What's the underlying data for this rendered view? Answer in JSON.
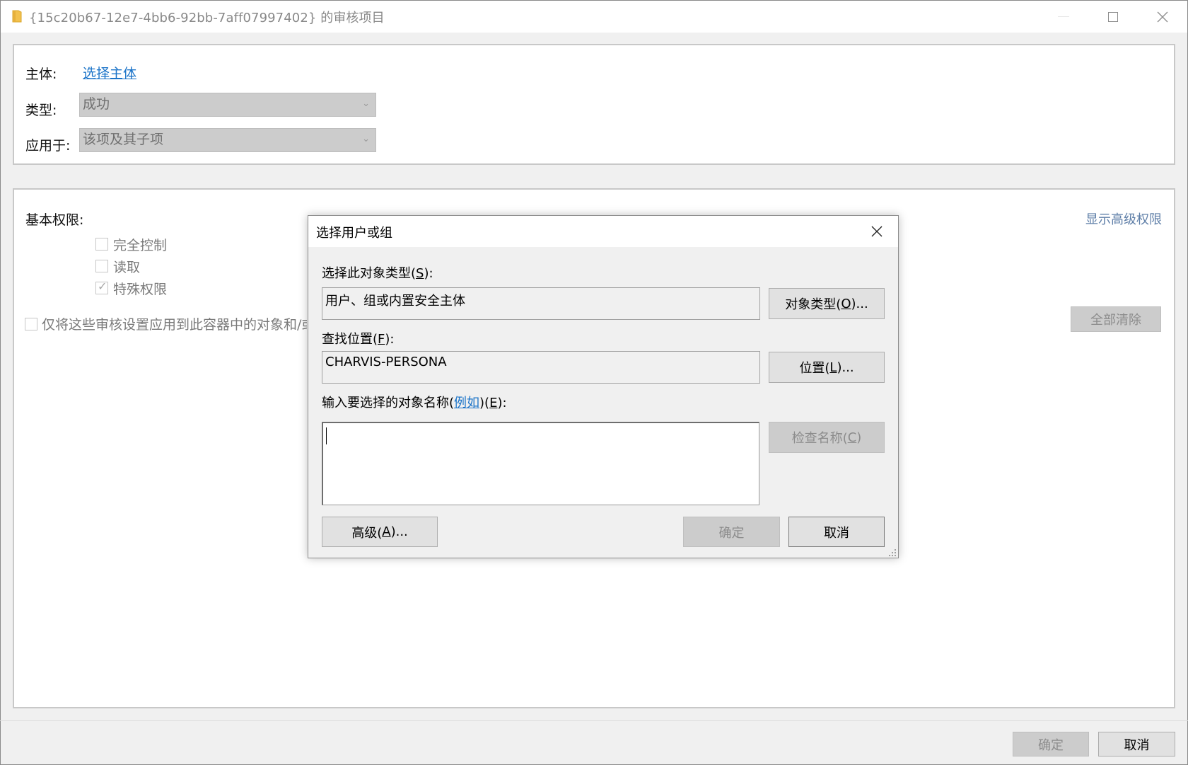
{
  "window": {
    "title": "{15c20b67-12e7-4bb6-92bb-7aff07997402} 的审核项目",
    "icon": "folder-icon"
  },
  "principal": {
    "label": "主体:",
    "link": "选择主体"
  },
  "type": {
    "label": "类型:",
    "value": "成功"
  },
  "applies_to": {
    "label": "应用于:",
    "value": "该项及其子项"
  },
  "permissions": {
    "label": "基本权限:",
    "show_advanced": "显示高级权限",
    "items": [
      {
        "label": "完全控制",
        "checked": false
      },
      {
        "label": "读取",
        "checked": false
      },
      {
        "label": "特殊权限",
        "checked": true
      }
    ],
    "apply_only_label": "仅将这些审核设置应用到此容器中的对象和/或",
    "clear_all": "全部清除"
  },
  "footer": {
    "ok": "确定",
    "cancel": "取消"
  },
  "dialog": {
    "title": "选择用户或组",
    "object_type_label_pre": "选择此对象类型(",
    "object_type_accel": "S",
    "object_type_label_post": "):",
    "object_type_value": "用户、组或内置安全主体",
    "object_type_btn_pre": "对象类型(",
    "object_type_btn_accel": "O",
    "object_type_btn_post": ")...",
    "location_label_pre": "查找位置(",
    "location_accel": "F",
    "location_label_post": "):",
    "location_value": "CHARVIS-PERSONA",
    "location_btn_pre": "位置(",
    "location_btn_accel": "L",
    "location_btn_post": ")...",
    "names_label_pre": "输入要选择的对象名称(",
    "names_example": "例如",
    "names_label_mid": ")(",
    "names_accel": "E",
    "names_label_post": "):",
    "names_value": "",
    "check_names_pre": "检查名称(",
    "check_names_accel": "C",
    "check_names_post": ")",
    "advanced_pre": "高级(",
    "advanced_accel": "A",
    "advanced_post": ")...",
    "ok": "确定",
    "cancel": "取消"
  }
}
